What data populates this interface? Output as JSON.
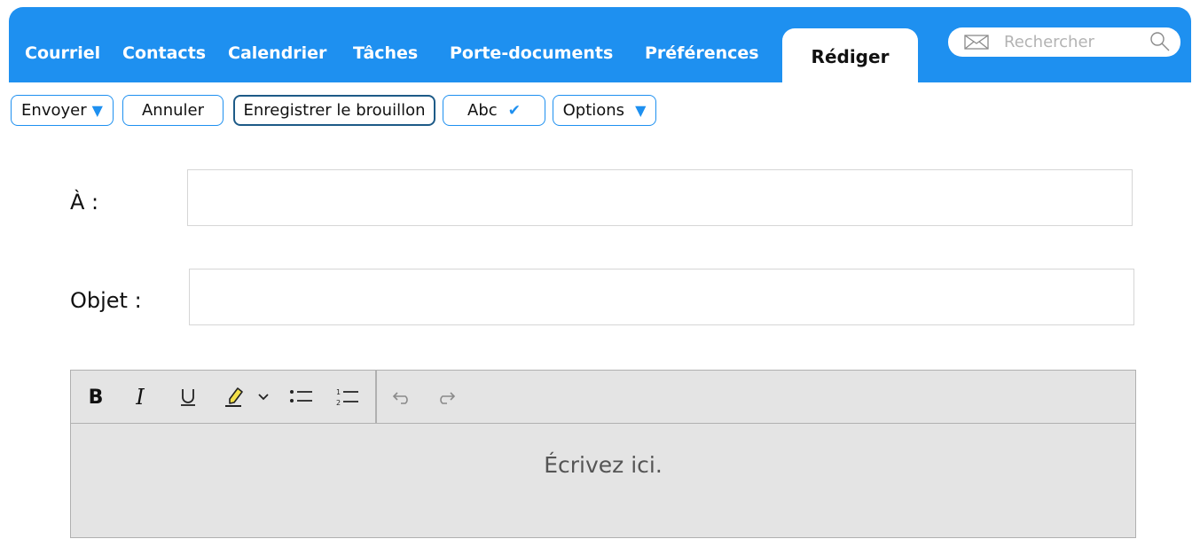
{
  "nav": {
    "items": [
      "Courriel",
      "Contacts",
      "Calendrier",
      "Tâches",
      "Porte-documents",
      "Préférences"
    ],
    "active_tab": "Rédiger"
  },
  "search": {
    "placeholder": "Rechercher",
    "icons": [
      "mail-icon",
      "search-icon"
    ]
  },
  "toolbar": {
    "send_label": "Envoyer",
    "cancel_label": "Annuler",
    "save_draft_label": "Enregistrer le brouillon",
    "spellcheck_label": "Abc",
    "options_label": "Options"
  },
  "form": {
    "to_label": "À :",
    "to_value": "",
    "subject_label": "Objet :",
    "subject_value": ""
  },
  "editor": {
    "format_buttons": [
      "bold-icon",
      "italic-icon",
      "underline-icon",
      "highlight-icon",
      "dropdown-chevron-icon",
      "bullet-list-icon",
      "numbered-list-icon",
      "undo-icon",
      "redo-icon"
    ],
    "placeholder": "Écrivez ici."
  },
  "colors": {
    "accent": "#1e90f0",
    "editor_bg": "#e4e4e4",
    "border": "#b0b0b0"
  }
}
